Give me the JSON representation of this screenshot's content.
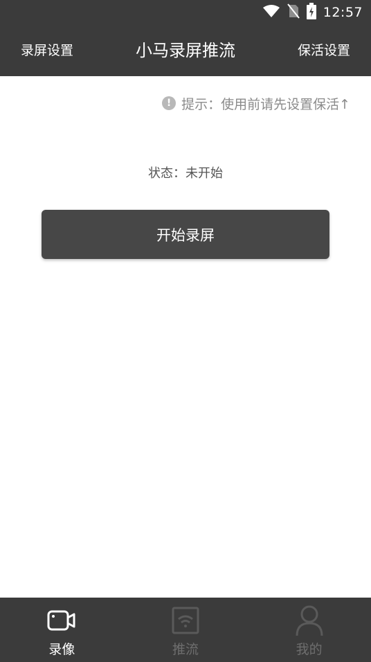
{
  "status_bar": {
    "time": "12:57"
  },
  "app_bar": {
    "left_action": "录屏设置",
    "title": "小马录屏推流",
    "right_action": "保活设置"
  },
  "hint": {
    "text": "提示：使用前请先设置保活↑"
  },
  "status": {
    "text": "状态：未开始"
  },
  "start_button": {
    "label": "开始录屏"
  },
  "bottom_nav": {
    "items": [
      {
        "label": "录像",
        "icon": "video-camera-icon",
        "active": true
      },
      {
        "label": "推流",
        "icon": "wifi-stream-icon",
        "active": false
      },
      {
        "label": "我的",
        "icon": "person-icon",
        "active": false
      }
    ]
  },
  "colors": {
    "bar": "#3b3b3b",
    "button": "#474747",
    "inactive": "#6e6e6e"
  }
}
